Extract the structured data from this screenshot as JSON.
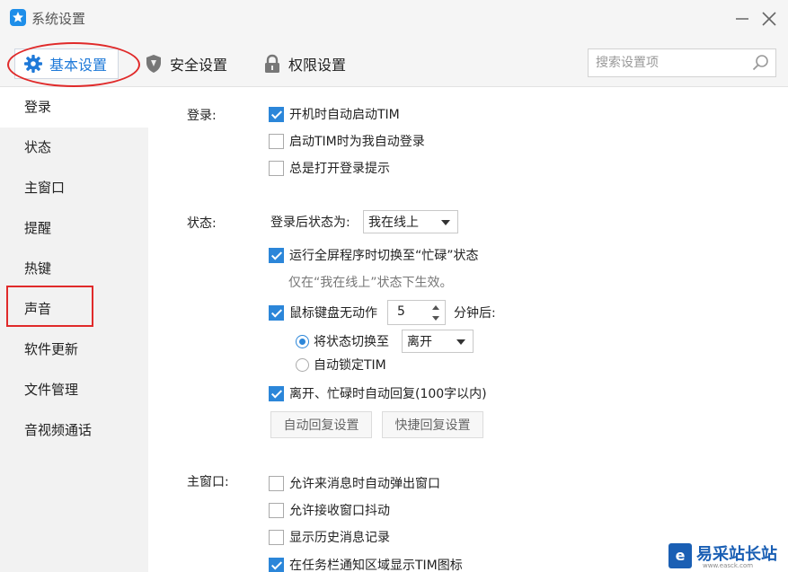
{
  "window": {
    "title": "系统设置"
  },
  "toolbar": {
    "tabs": [
      {
        "label": "基本设置",
        "icon": "gear-icon",
        "active": true
      },
      {
        "label": "安全设置",
        "icon": "shield-icon",
        "active": false
      },
      {
        "label": "权限设置",
        "icon": "lock-icon",
        "active": false
      }
    ],
    "search_placeholder": "搜索设置项"
  },
  "sidebar": {
    "items": [
      {
        "label": "登录",
        "active": true
      },
      {
        "label": "状态",
        "active": false
      },
      {
        "label": "主窗口",
        "active": false
      },
      {
        "label": "提醒",
        "active": false
      },
      {
        "label": "热键",
        "active": false
      },
      {
        "label": "声音",
        "active": false
      },
      {
        "label": "软件更新",
        "active": false
      },
      {
        "label": "文件管理",
        "active": false
      },
      {
        "label": "音视频通话",
        "active": false
      }
    ]
  },
  "login": {
    "label": "登录:",
    "options": [
      {
        "label": "开机时自动启动TIM",
        "checked": true
      },
      {
        "label": "启动TIM时为我自动登录",
        "checked": false
      },
      {
        "label": "总是打开登录提示",
        "checked": false
      }
    ]
  },
  "status": {
    "label": "状态:",
    "after_login_label": "登录后状态为:",
    "after_login_value": "我在线上",
    "fullscreen_busy": {
      "label": "运行全屏程序时切换至“忙碌”状态",
      "checked": true
    },
    "fullscreen_hint": "仅在“我在线上”状态下生效。",
    "idle": {
      "label": "鼠标键盘无动作",
      "checked": true,
      "minutes": "5",
      "suffix": "分钟后:"
    },
    "switch_to": {
      "label": "将状态切换至",
      "selected": true,
      "value": "离开"
    },
    "auto_lock": {
      "label": "自动锁定TIM",
      "selected": false
    },
    "auto_reply": {
      "label": "离开、忙碌时自动回复(100字以内)",
      "checked": true
    },
    "buttons": {
      "auto_reply_settings": "自动回复设置",
      "quick_reply_settings": "快捷回复设置"
    }
  },
  "main_window": {
    "label": "主窗口:",
    "options": [
      {
        "label": "允许来消息时自动弹出窗口",
        "checked": false
      },
      {
        "label": "允许接收窗口抖动",
        "checked": false
      },
      {
        "label": "显示历史消息记录",
        "checked": false
      },
      {
        "label": "在任务栏通知区域显示TIM图标",
        "checked": true
      }
    ]
  },
  "watermark": {
    "logo_char": "e",
    "text": "易采站长站",
    "sub": "www.easck.com"
  },
  "colors": {
    "accent": "#2b86d9",
    "highlight": "#e02a2a"
  }
}
